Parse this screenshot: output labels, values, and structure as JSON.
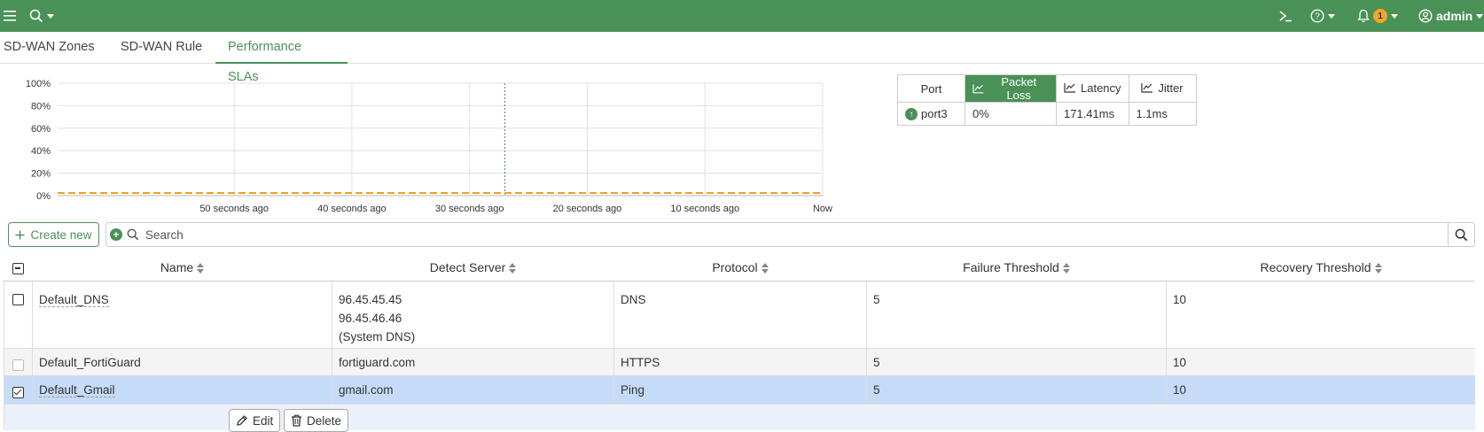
{
  "topbar": {
    "menu_icon": "hamburger-icon",
    "search_icon": "search-icon",
    "terminal_icon": "terminal-icon",
    "help_icon": "help-icon",
    "notification_icon": "bell-icon",
    "notification_count": "1",
    "user_icon": "user-circle-icon",
    "user_label": "admin"
  },
  "tabs": [
    {
      "label": "SD-WAN Zones"
    },
    {
      "label": "SD-WAN Rule"
    },
    {
      "label": "Performance SLAs"
    }
  ],
  "chart_data": {
    "type": "line",
    "y_ticks": [
      "100%",
      "80%",
      "60%",
      "40%",
      "20%",
      "0%"
    ],
    "x_ticks": [
      "50 seconds ago",
      "40 seconds ago",
      "30 seconds ago",
      "20 seconds ago",
      "10 seconds ago",
      "Now"
    ],
    "ylim": [
      0,
      100
    ],
    "grid": true,
    "series": [
      {
        "name": "port3",
        "color": "#f0a020",
        "values": [
          0,
          0,
          0,
          0,
          0,
          0
        ]
      }
    ],
    "cursor_x_seconds_ago": 27
  },
  "sla_table": {
    "headers": {
      "port": "Port",
      "packet_loss": "Packet Loss",
      "latency": "Latency",
      "jitter": "Jitter"
    },
    "rows": [
      {
        "port": "port3",
        "packet_loss": "0%",
        "latency": "171.41ms",
        "jitter": "1.1ms",
        "status": "up"
      }
    ]
  },
  "toolbar": {
    "create_label": "Create new",
    "search_placeholder": "Search"
  },
  "grid": {
    "columns": [
      "Name",
      "Detect Server",
      "Protocol",
      "Failure Threshold",
      "Recovery Threshold"
    ],
    "rows": [
      {
        "name": "Default_DNS",
        "server1": "96.45.45.45",
        "server2": "96.45.46.46",
        "server3": "(System DNS)",
        "protocol": "DNS",
        "failure": "5",
        "recovery": "10",
        "checked": false
      },
      {
        "name": "Default_FortiGuard",
        "server1": "fortiguard.com",
        "protocol": "HTTPS",
        "failure": "5",
        "recovery": "10",
        "checked": false
      },
      {
        "name": "Default_Gmail",
        "server1": "gmail.com",
        "protocol": "Ping",
        "failure": "5",
        "recovery": "10",
        "checked": true
      }
    ],
    "edit_label": "Edit",
    "delete_label": "Delete"
  }
}
